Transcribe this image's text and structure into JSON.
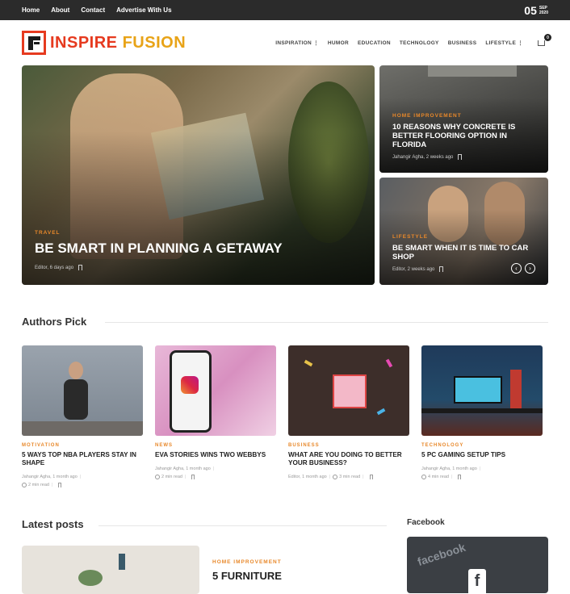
{
  "topbar": {
    "links": [
      "Home",
      "About",
      "Contact",
      "Advertise With Us"
    ],
    "date_day": "05",
    "date_month": "SEP",
    "date_year": "2020"
  },
  "header": {
    "logo_part1": "INSPIRE",
    "logo_part2": "FUSION",
    "nav": [
      "INSPIRATION",
      "HUMOR",
      "EDUCATION",
      "TECHNOLOGY",
      "BUSINESS",
      "LIFESTYLE"
    ],
    "cart_count": "0"
  },
  "hero": {
    "main": {
      "category": "TRAVEL",
      "title": "BE SMART IN PLANNING A GETAWAY",
      "byline": "Editor, 6 days ago"
    },
    "side1": {
      "category": "HOME IMPROVEMENT",
      "title": "10 REASONS WHY CONCRETE IS BETTER FLOORING OPTION IN FLORIDA",
      "byline": "Jahangir Agha, 2 weeks ago"
    },
    "side2": {
      "category": "LIFESTYLE",
      "title": "BE SMART WHEN IT IS TIME TO CAR SHOP",
      "byline": "Editor, 2 weeks ago"
    }
  },
  "authors_pick": {
    "heading": "Authors Pick",
    "items": [
      {
        "category": "MOTIVATION",
        "title": "5 WAYS TOP NBA PLAYERS STAY IN SHAPE",
        "author": "Jahangir Agha, 1 month ago",
        "read": "2 min read"
      },
      {
        "category": "NEWS",
        "title": "EVA STORIES WINS TWO WEBBYS",
        "author": "Jahangir Agha, 1 month ago",
        "read": "2 min read"
      },
      {
        "category": "BUSINESS",
        "title": "WHAT ARE YOU DOING TO BETTER YOUR BUSINESS?",
        "author": "Editor, 1 month ago",
        "read": "3 min read"
      },
      {
        "category": "TECHNOLOGY",
        "title": "5 PC GAMING SETUP TIPS",
        "author": "Jahangir Agha, 1 month ago",
        "read": "4 min read"
      }
    ]
  },
  "latest": {
    "heading": "Latest posts",
    "first": {
      "category": "HOME IMPROVEMENT",
      "title": "5 FURNITURE"
    }
  },
  "sidebar": {
    "facebook_heading": "Facebook",
    "facebook_image_text": "facebook"
  },
  "colors": {
    "accent": "#e8882a",
    "topbar": "#2b2b2b"
  }
}
